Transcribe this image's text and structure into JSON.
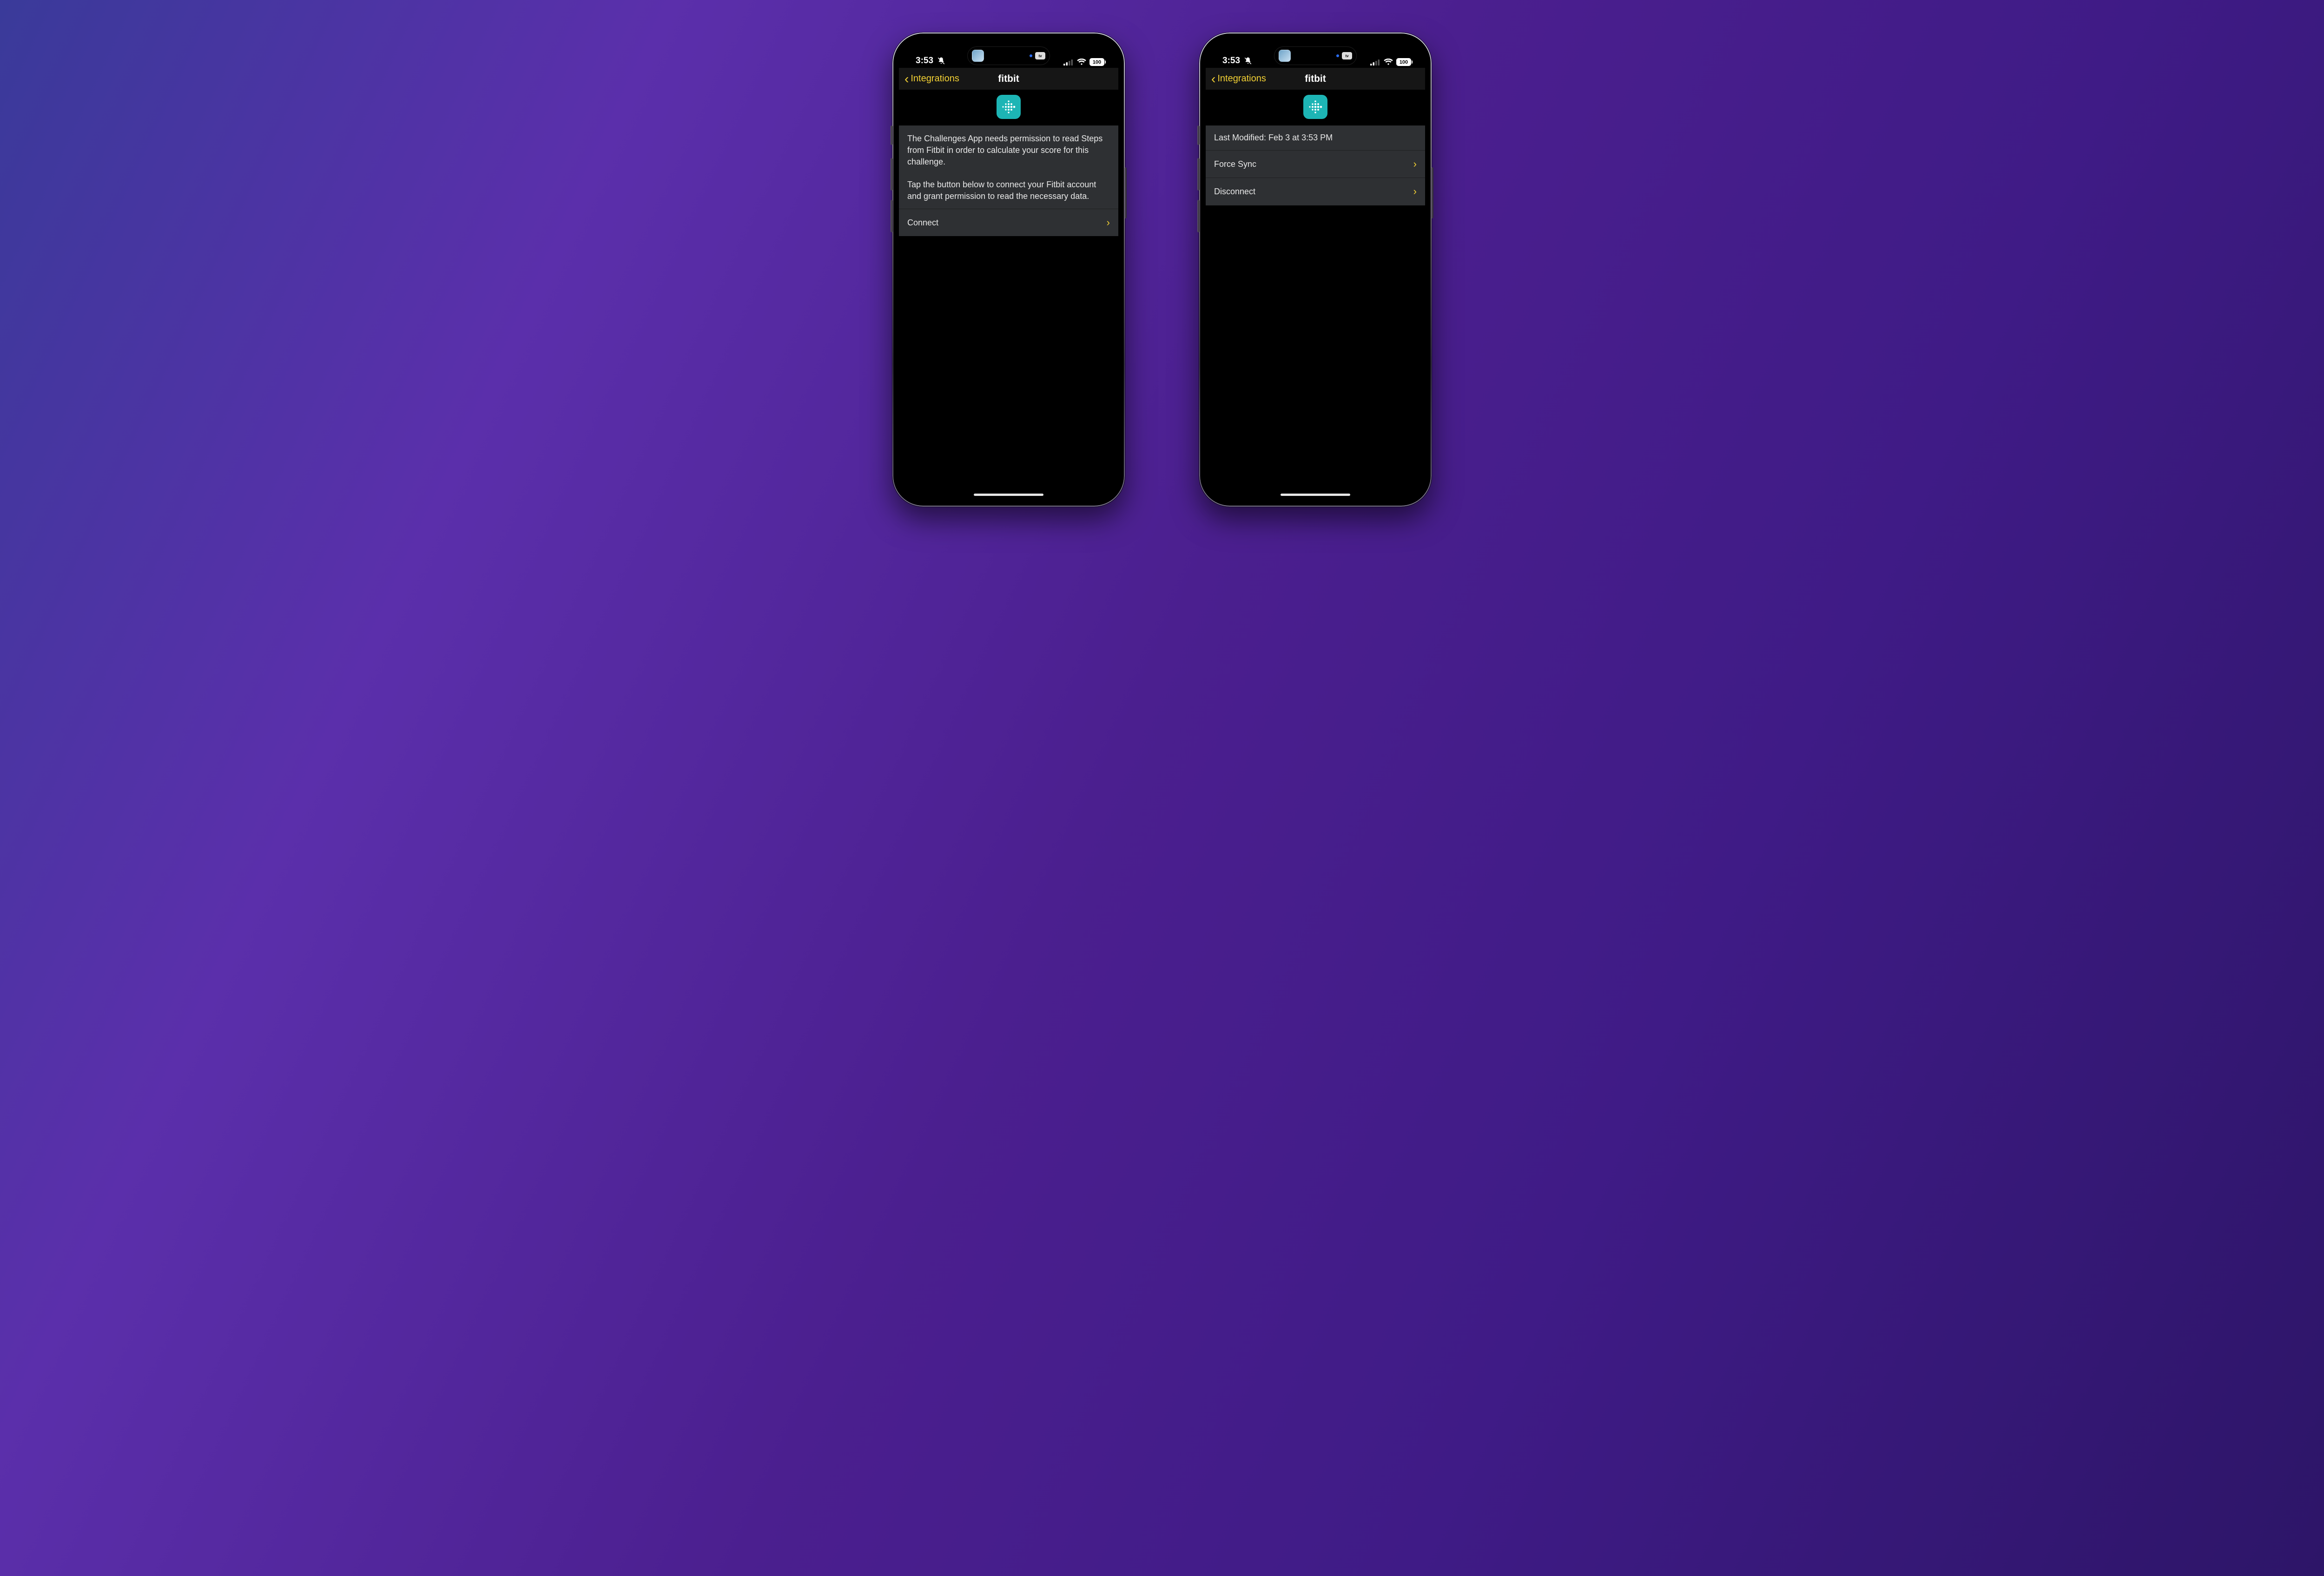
{
  "status": {
    "time": "3:53",
    "battery": "100"
  },
  "nav": {
    "back": "Integrations",
    "title": "fitbit"
  },
  "left": {
    "info": "The Challenges App needs permission to read Steps from Fitbit in order to calculate your score for this challenge.\n\n Tap the button below to connect your Fitbit account and grant permission to read the necessary data.",
    "connect": "Connect"
  },
  "right": {
    "last_modified": "Last Modified: Feb 3 at 3:53 PM",
    "force_sync": "Force Sync",
    "disconnect": "Disconnect"
  }
}
